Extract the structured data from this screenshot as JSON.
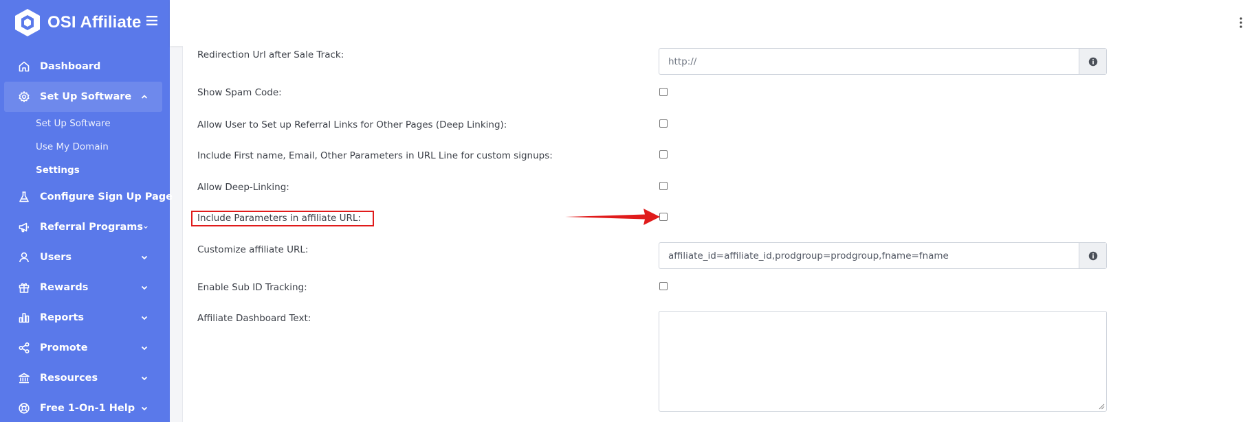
{
  "app": {
    "brand": "OSI Affiliate"
  },
  "sidebar": {
    "items": [
      {
        "label": "Dashboard",
        "icon": "home-icon"
      },
      {
        "label": "Set Up Software",
        "icon": "gear-icon",
        "expanded": true
      },
      {
        "label": "Configure Sign Up Page",
        "icon": "flask-icon"
      },
      {
        "label": "Referral Programs",
        "icon": "megaphone-icon"
      },
      {
        "label": "Users",
        "icon": "user-icon"
      },
      {
        "label": "Rewards",
        "icon": "gift-icon"
      },
      {
        "label": "Reports",
        "icon": "bar-chart-icon"
      },
      {
        "label": "Promote",
        "icon": "share-icon"
      },
      {
        "label": "Resources",
        "icon": "bank-icon"
      },
      {
        "label": "Free 1-On-1 Help",
        "icon": "lifebuoy-icon"
      }
    ],
    "subitems": [
      {
        "label": "Set Up Software"
      },
      {
        "label": "Use My Domain"
      },
      {
        "label": "Settings",
        "current": true
      }
    ]
  },
  "form": {
    "redirection_url": {
      "label": "Redirection Url after Sale Track:",
      "placeholder": "http://"
    },
    "show_spam_code": {
      "label": "Show Spam Code:",
      "checked": false
    },
    "deep_linking_other_pages": {
      "label": "Allow User to Set up Referral Links for Other Pages (Deep Linking):",
      "checked": false
    },
    "include_first_name": {
      "label": "Include First name, Email, Other Parameters in URL Line for custom signups:",
      "checked": false
    },
    "allow_deep_linking": {
      "label": "Allow Deep-Linking:",
      "checked": false
    },
    "include_parameters": {
      "label": "Include Parameters in affiliate URL:",
      "checked": false
    },
    "customize_url": {
      "label": "Customize affiliate URL:",
      "value": "affiliate_id=affiliate_id,prodgroup=prodgroup,fname=fname"
    },
    "sub_id_tracking": {
      "label": "Enable Sub ID Tracking:",
      "checked": false
    },
    "dashboard_text": {
      "label": "Affiliate Dashboard Text:",
      "value": ""
    }
  },
  "colors": {
    "sidebar": "#5a79ea",
    "annotation": "#e01b1b"
  }
}
